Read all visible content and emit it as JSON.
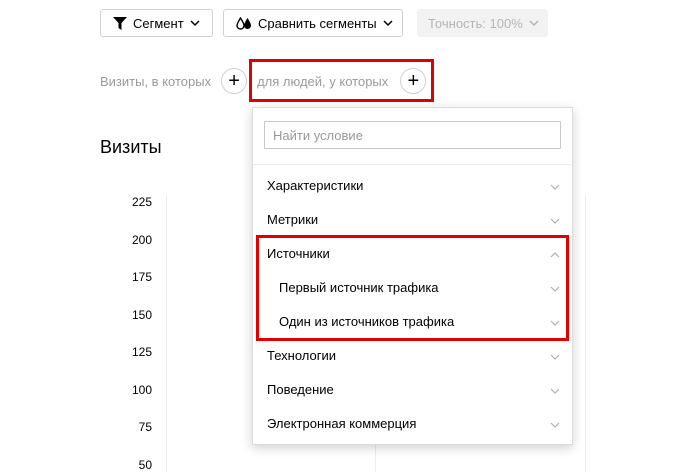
{
  "toolbar": {
    "segment_label": "Сегмент",
    "compare_label": "Сравнить сегменты",
    "accuracy_label": "Точность: 100%"
  },
  "conditions": {
    "visits_label": "Визиты, в которых",
    "people_label": "для людей, у которых",
    "add_symbol": "+"
  },
  "chart": {
    "title": "Визиты",
    "y_ticks": [
      "225",
      "200",
      "175",
      "150",
      "125",
      "100",
      "75",
      "50"
    ]
  },
  "dropdown": {
    "search_placeholder": "Найти условие",
    "items": [
      {
        "label": "Характеристики",
        "expanded": false
      },
      {
        "label": "Метрики",
        "expanded": false
      },
      {
        "label": "Источники",
        "expanded": true
      },
      {
        "label": "Первый источник трафика",
        "expanded": false
      },
      {
        "label": "Один из источников трафика",
        "expanded": false
      },
      {
        "label": "Технологии",
        "expanded": false
      },
      {
        "label": "Поведение",
        "expanded": false
      },
      {
        "label": "Электронная коммерция",
        "expanded": false
      }
    ]
  },
  "colors": {
    "highlight": "#e00000",
    "muted_text": "#9a9a9a",
    "border": "#d0d0d0"
  }
}
